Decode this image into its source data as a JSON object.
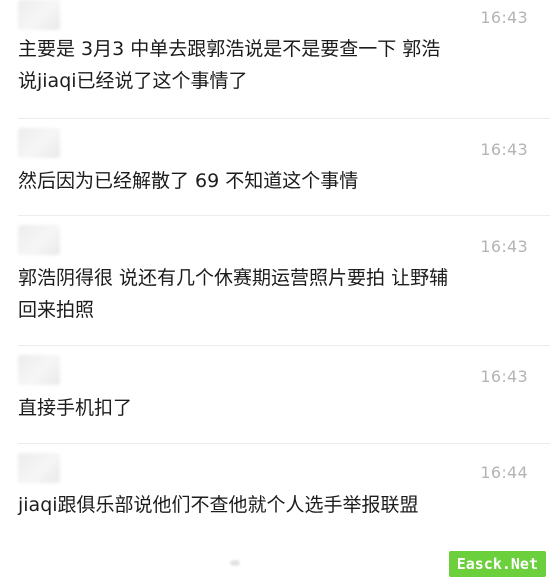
{
  "messages": [
    {
      "time": "16:43",
      "text": "主要是 3月3 中单去跟郭浩说是不是要查一下 郭浩\n说jiaqi已经说了这个事情了"
    },
    {
      "time": "16:43",
      "text": "然后因为已经解散了 69 不知道这个事情"
    },
    {
      "time": "16:43",
      "text": "郭浩阴得很 说还有几个休赛期运营照片要拍 让野辅\n回来拍照"
    },
    {
      "time": "16:43",
      "text": "直接手机扣了"
    },
    {
      "time": "16:44",
      "text": "jiaqi跟俱乐部说他们不查他就个人选手举报联盟"
    }
  ],
  "watermark": "Easck.Net",
  "colors": {
    "time": "#b4b4b4",
    "text": "#1c1c1c",
    "divider": "#ececec",
    "watermark_bg": "#6ccf3c"
  }
}
